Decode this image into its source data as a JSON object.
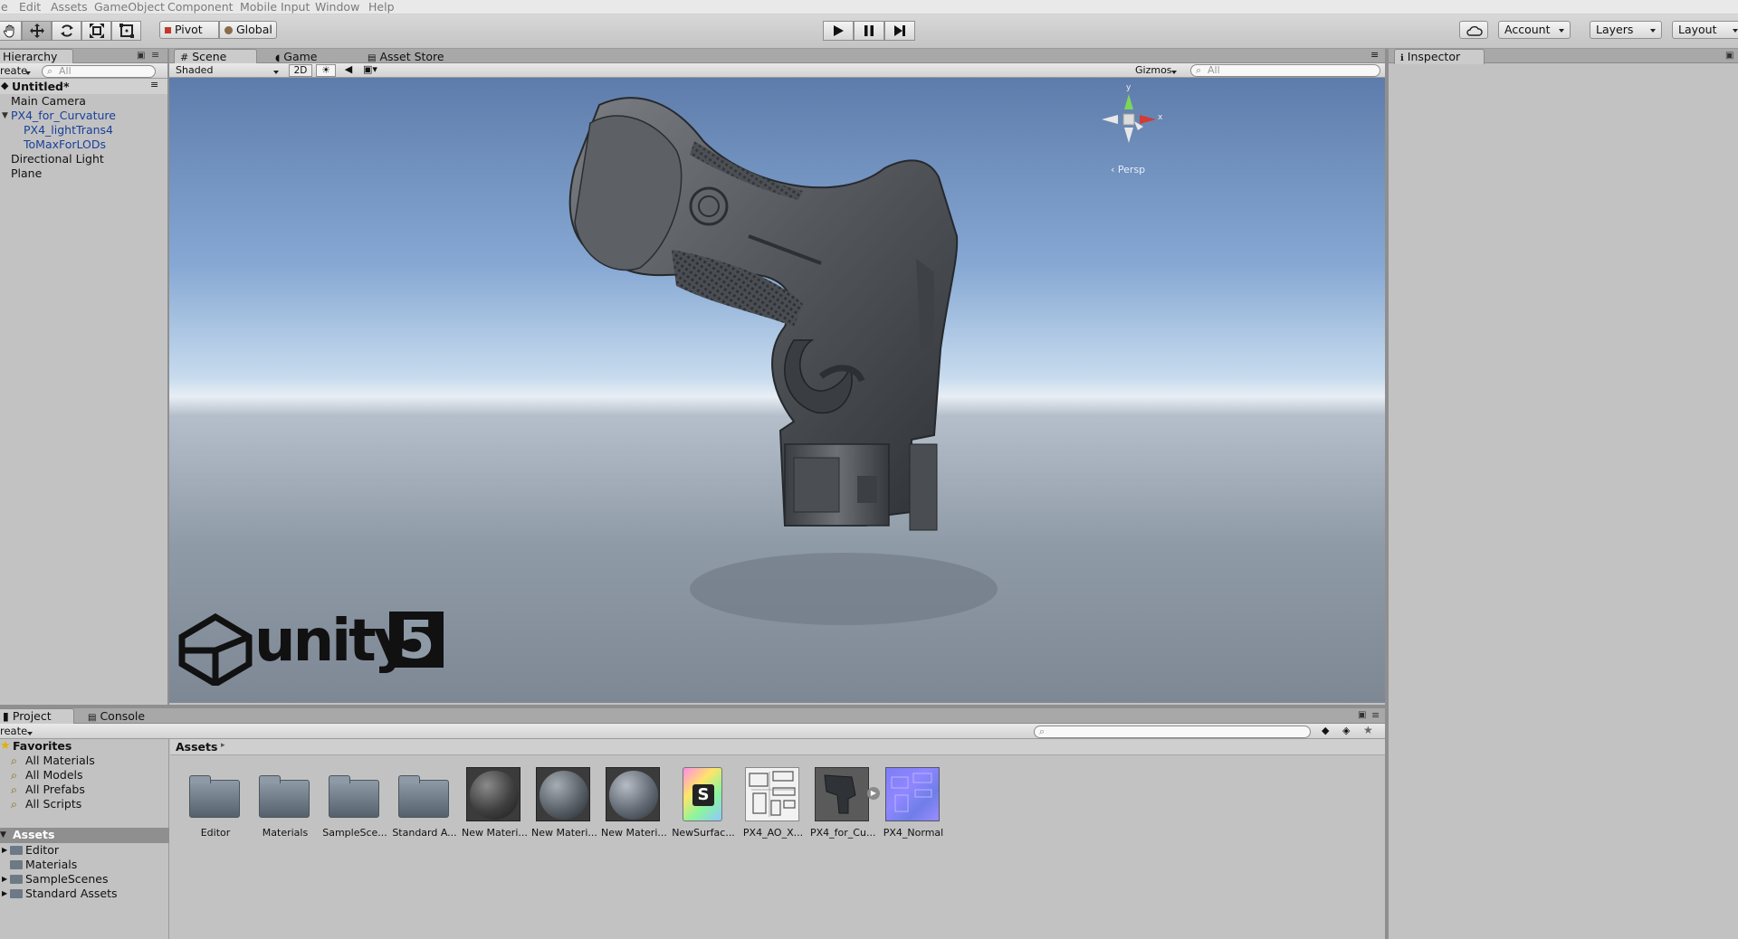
{
  "menu": [
    "e",
    "Edit",
    "Assets",
    "GameObject",
    "Component",
    "Mobile Input",
    "Window",
    "Help"
  ],
  "toolbar": {
    "pivot": "Pivot",
    "global": "Global",
    "account": "Account",
    "layers": "Layers",
    "layout": "Layout"
  },
  "hierarchy": {
    "tab": "Hierarchy",
    "create": "reate",
    "search": "All",
    "scene": "Untitled*",
    "items": [
      "Main Camera",
      "PX4_for_Curvature",
      "PX4_lightTrans4",
      "ToMaxForLODs",
      "Directional Light",
      "Plane"
    ]
  },
  "sceneTabs": {
    "scene": "Scene",
    "game": "Game",
    "assetStore": "Asset Store"
  },
  "sceneBar": {
    "shading": "Shaded",
    "mode2d": "2D",
    "gizmos": "Gizmos",
    "search": "All"
  },
  "sceneView": {
    "persp": "Persp",
    "gizmoY": "y",
    "gizmoX": "x",
    "logoText": "unity",
    "logoNum": "5"
  },
  "inspector": {
    "tab": "Inspector"
  },
  "project": {
    "tab": "Project",
    "consoleTab": "Console",
    "create": "reate",
    "breadcrumb": "Assets",
    "favorites": {
      "header": "Favorites",
      "items": [
        "All Materials",
        "All Models",
        "All Prefabs",
        "All Scripts"
      ]
    },
    "assetsTree": {
      "header": "Assets",
      "items": [
        "Editor",
        "Materials",
        "SampleScenes",
        "Standard Assets"
      ]
    },
    "assets": [
      "Editor",
      "Materials",
      "SampleSce...",
      "Standard A...",
      "New Materi...",
      "New Materi...",
      "New Materi...",
      "NewSurfac...",
      "PX4_AO_X...",
      "PX4_for_Cu...",
      "PX4_Normal"
    ]
  },
  "colors": {
    "background": "#c2c2c2",
    "hierarchyLink": "#1a3f9a",
    "sceneSky": "#86a8d3"
  }
}
